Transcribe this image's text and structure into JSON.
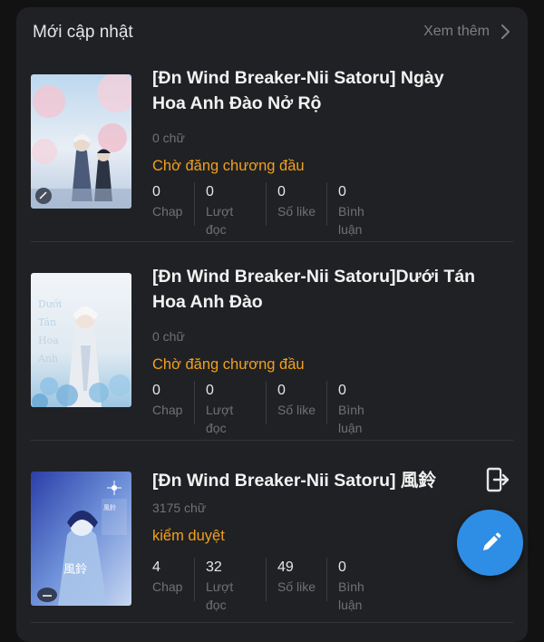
{
  "section": {
    "title": "Mới cập nhật",
    "see_more": "Xem thêm"
  },
  "stat_labels": {
    "chap": "Chap",
    "reads": "Lượt đọc",
    "likes": "Số like",
    "comments": "Bình luận"
  },
  "stories": [
    {
      "title": "[Đn Wind Breaker-Nii Satoru] Ngày Hoa Anh Đào Nở Rộ",
      "word_count": "0 chữ",
      "status": "Chờ đăng chương đầu",
      "chap": "0",
      "reads": "0",
      "likes": "0",
      "comments": "0"
    },
    {
      "title": "[Đn Wind Breaker-Nii Satoru]Dưới Tán Hoa Anh Đào",
      "word_count": "0 chữ",
      "status": "Chờ đăng chương đầu",
      "chap": "0",
      "reads": "0",
      "likes": "0",
      "comments": "0"
    },
    {
      "title": "[Đn Wind Breaker-Nii Satoru] 風鈴",
      "word_count": "3175 chữ",
      "status": "kiểm duyệt",
      "chap": "4",
      "reads": "32",
      "likes": "49",
      "comments": "0"
    }
  ],
  "colors": {
    "status": "#f0a020",
    "fab": "#2e8ee6"
  },
  "icons": {
    "see_more": "chevron-right-icon",
    "exit": "exit-icon",
    "fab": "pencil-icon"
  }
}
